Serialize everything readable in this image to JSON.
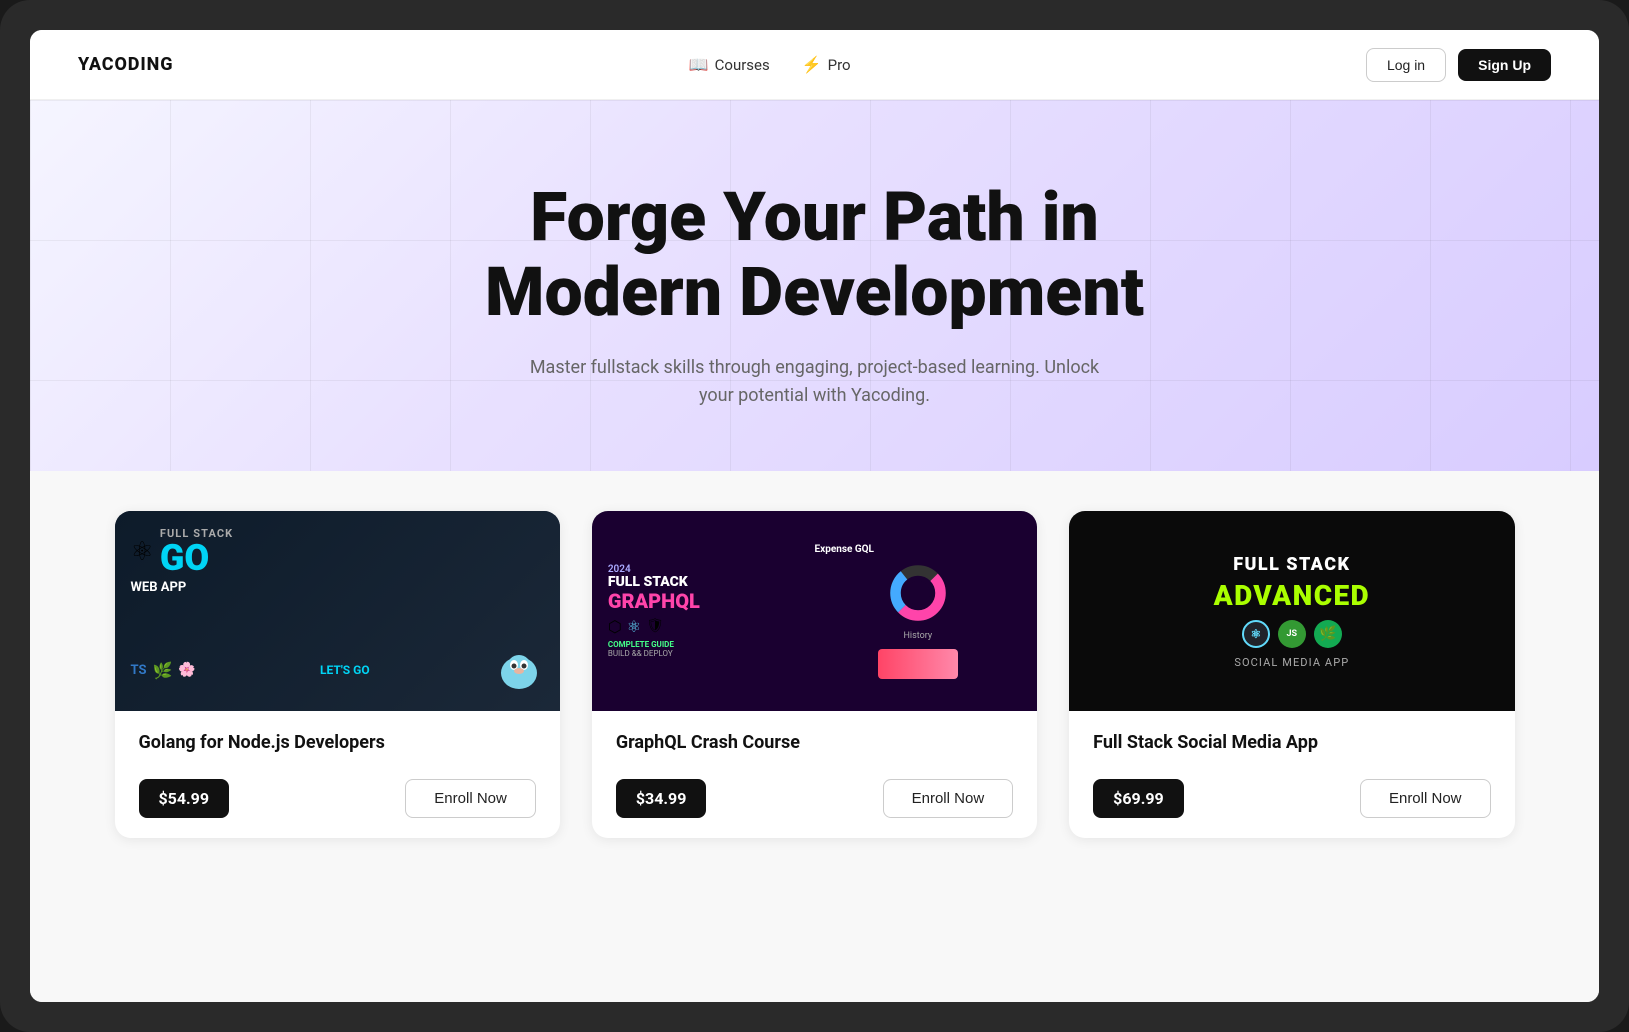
{
  "brand": {
    "name": "YACODING"
  },
  "navbar": {
    "courses_label": "Courses",
    "pro_label": "Pro",
    "login_label": "Log in",
    "signup_label": "Sign Up"
  },
  "hero": {
    "title": "Forge Your Path in Modern Development",
    "subtitle": "Master fullstack skills through engaging, project-based learning. Unlock your potential with Yacoding."
  },
  "courses": [
    {
      "id": 1,
      "title": "Golang for Node.js Developers",
      "price": "$54.99",
      "enroll_label": "Enroll Now",
      "thumbnail_type": "golang"
    },
    {
      "id": 2,
      "title": "GraphQL Crash Course",
      "price": "$34.99",
      "enroll_label": "Enroll Now",
      "thumbnail_type": "graphql"
    },
    {
      "id": 3,
      "title": "Full Stack Social Media App",
      "price": "$69.99",
      "enroll_label": "Enroll Now",
      "thumbnail_type": "social"
    }
  ],
  "thumbnails": {
    "golang": {
      "go_label": "GO",
      "fullstack": "FULL STACK",
      "webapp": "WEB APP",
      "lets": "LET'S",
      "lets_go": "GO"
    },
    "graphql": {
      "year": "2024",
      "fullstack": "FULL STACK",
      "graphql": "GRAPHQL",
      "complete": "COMPLETE GUIDE",
      "build": "BUILD && DEPLOY",
      "expense": "Expense GQL",
      "history": "History"
    },
    "social": {
      "fullstack": "FULL STACK",
      "advanced": "ADVANCED",
      "social_media": "SOCIAL MEDIA",
      "app": "APP"
    }
  }
}
